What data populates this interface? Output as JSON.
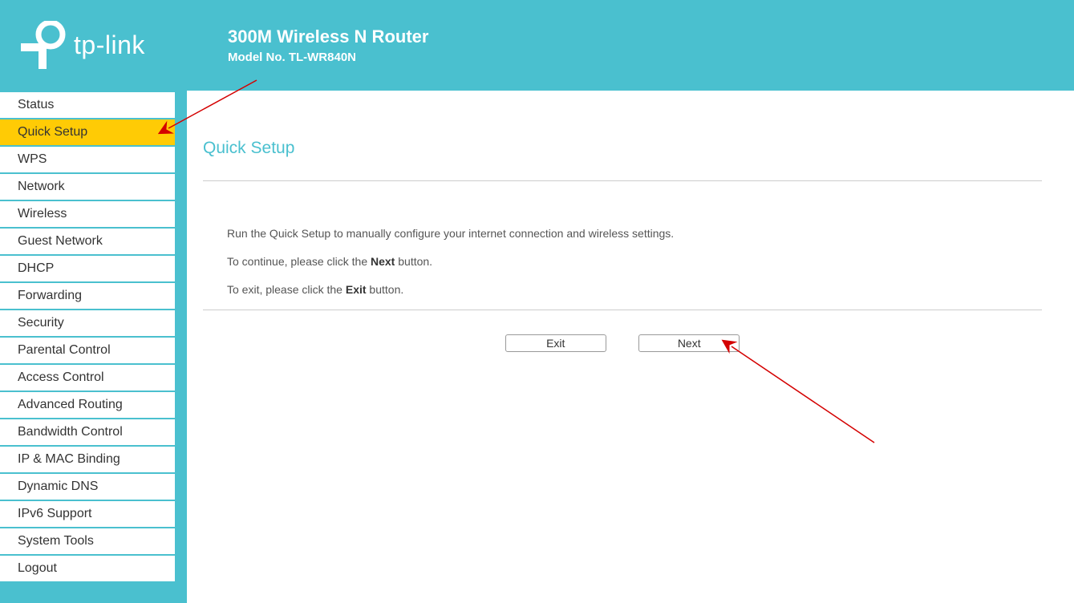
{
  "header": {
    "brand": "tp-link",
    "title": "300M Wireless N Router",
    "subtitle": "Model No. TL-WR840N"
  },
  "sidebar": {
    "items": [
      {
        "label": "Status",
        "active": false
      },
      {
        "label": "Quick Setup",
        "active": true
      },
      {
        "label": "WPS",
        "active": false
      },
      {
        "label": "Network",
        "active": false
      },
      {
        "label": "Wireless",
        "active": false
      },
      {
        "label": "Guest Network",
        "active": false
      },
      {
        "label": "DHCP",
        "active": false
      },
      {
        "label": "Forwarding",
        "active": false
      },
      {
        "label": "Security",
        "active": false
      },
      {
        "label": "Parental Control",
        "active": false
      },
      {
        "label": "Access Control",
        "active": false
      },
      {
        "label": "Advanced Routing",
        "active": false
      },
      {
        "label": "Bandwidth Control",
        "active": false
      },
      {
        "label": "IP & MAC Binding",
        "active": false
      },
      {
        "label": "Dynamic DNS",
        "active": false
      },
      {
        "label": "IPv6 Support",
        "active": false
      },
      {
        "label": "System Tools",
        "active": false
      },
      {
        "label": "Logout",
        "active": false
      }
    ]
  },
  "main": {
    "page_title": "Quick Setup",
    "intro_line": "Run the Quick Setup to manually configure your internet connection and wireless settings.",
    "continue_prefix": "To continue, please click the ",
    "continue_bold": "Next",
    "continue_suffix": " button.",
    "exit_prefix": "To exit, please click the ",
    "exit_bold": "Exit",
    "exit_suffix": "  button.",
    "buttons": {
      "exit": "Exit",
      "next": "Next"
    }
  }
}
